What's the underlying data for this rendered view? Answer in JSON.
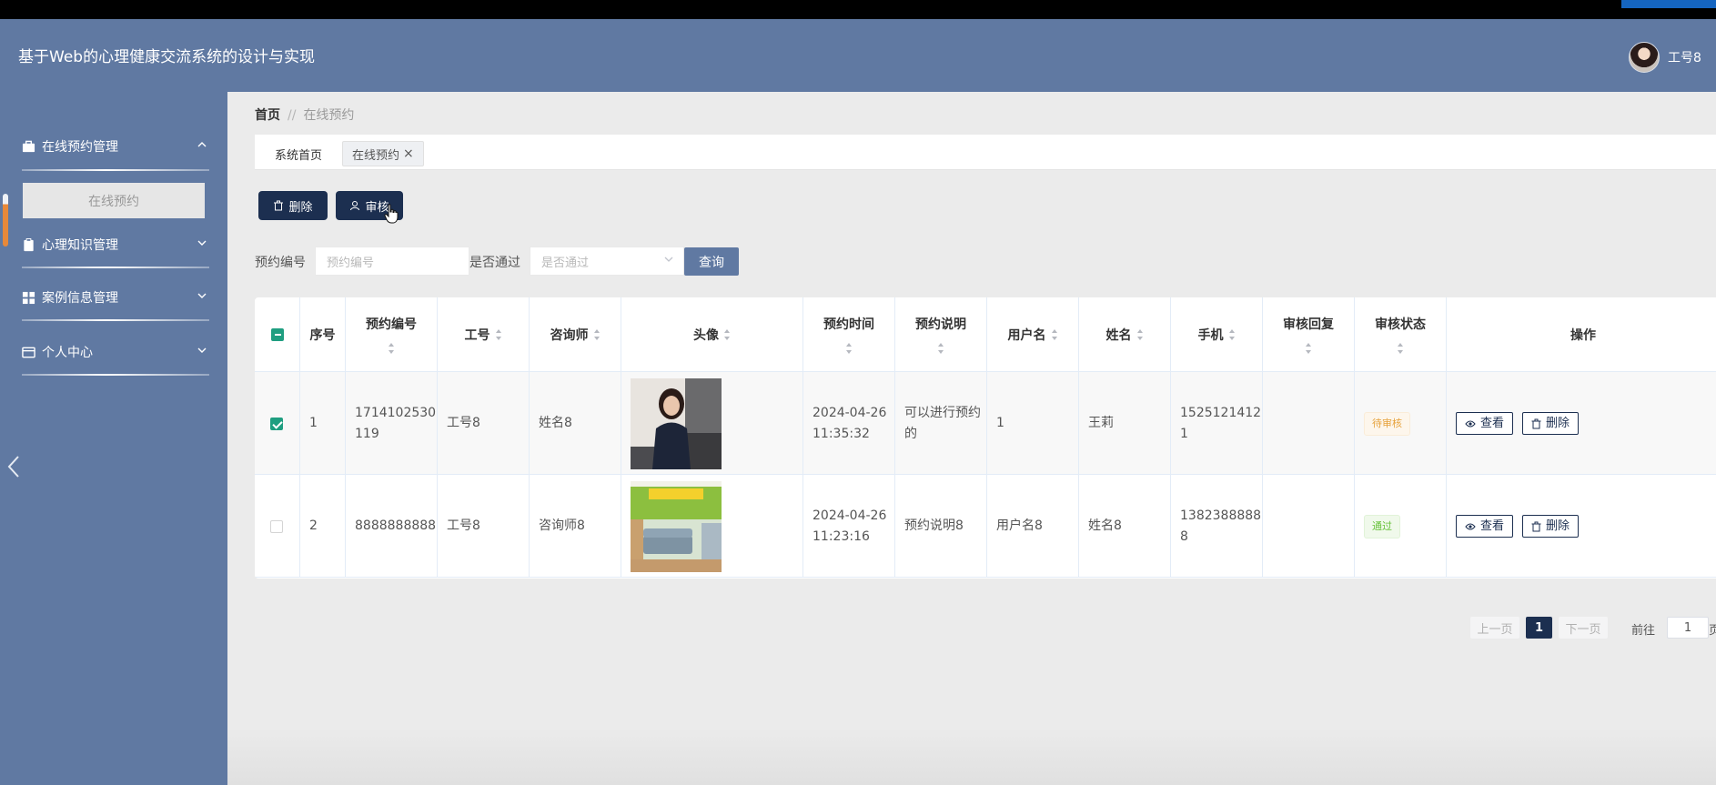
{
  "header": {
    "title": "基于Web的心理健康交流系统的设计与实现",
    "user_name": "工号8"
  },
  "sidebar": {
    "menus": [
      {
        "label": "在线预约管理",
        "icon": "briefcase-icon",
        "expanded": true
      },
      {
        "label": "心理知识管理",
        "icon": "clipboard-icon",
        "expanded": false
      },
      {
        "label": "案例信息管理",
        "icon": "grid-icon",
        "expanded": false
      },
      {
        "label": "个人中心",
        "icon": "id-card-icon",
        "expanded": false
      }
    ],
    "active_sub_item": "在线预约"
  },
  "breadcrumb": {
    "home": "首页",
    "separator": "//",
    "current": "在线预约"
  },
  "tabs": [
    {
      "label": "系统首页"
    },
    {
      "label": "在线预约",
      "closable": true,
      "close_glyph": "×"
    }
  ],
  "toolbar": {
    "delete_label": "删除",
    "audit_label": "审核"
  },
  "filters": {
    "appointment_no_label": "预约编号",
    "appointment_no_placeholder": "预约编号",
    "passed_label": "是否通过",
    "passed_placeholder": "是否通过",
    "query_label": "查询"
  },
  "table": {
    "headers": [
      "序号",
      "预约编号",
      "工号",
      "咨询师",
      "头像",
      "预约时间",
      "预约说明",
      "用户名",
      "姓名",
      "手机",
      "审核回复",
      "审核状态",
      "操作"
    ],
    "rows": [
      {
        "checked": true,
        "index": "1",
        "appointment_no": "1714102530119",
        "staff_no": "工号8",
        "counselor": "姓名8",
        "photo": "woman-portrait",
        "time": "2024-04-26 11:35:32",
        "description": "可以进行预约的",
        "username": "1",
        "name": "王莉",
        "phone": "15251214121",
        "reply": "",
        "status": "待审核",
        "status_kind": "pending"
      },
      {
        "checked": false,
        "index": "2",
        "appointment_no": "8888888888",
        "staff_no": "工号8",
        "counselor": "咨询师8",
        "photo": "counseling-room",
        "time": "2024-04-26 11:23:16",
        "description": "预约说明8",
        "username": "用户名8",
        "name": "姓名8",
        "phone": "13823888888",
        "reply": "",
        "status": "通过",
        "status_kind": "pass"
      }
    ],
    "actions": {
      "view_label": "查看",
      "delete_label": "删除"
    }
  },
  "pagination": {
    "prev_label": "上一页",
    "current_page": "1",
    "next_label": "下一页",
    "goto_label": "前往",
    "goto_value": "1",
    "unit_label": "页"
  },
  "colors": {
    "primary": "#6079a2",
    "dark": "#1c2f50",
    "accent": "#1f9e80",
    "pending": "#e6a23c",
    "pass": "#67c23a"
  }
}
